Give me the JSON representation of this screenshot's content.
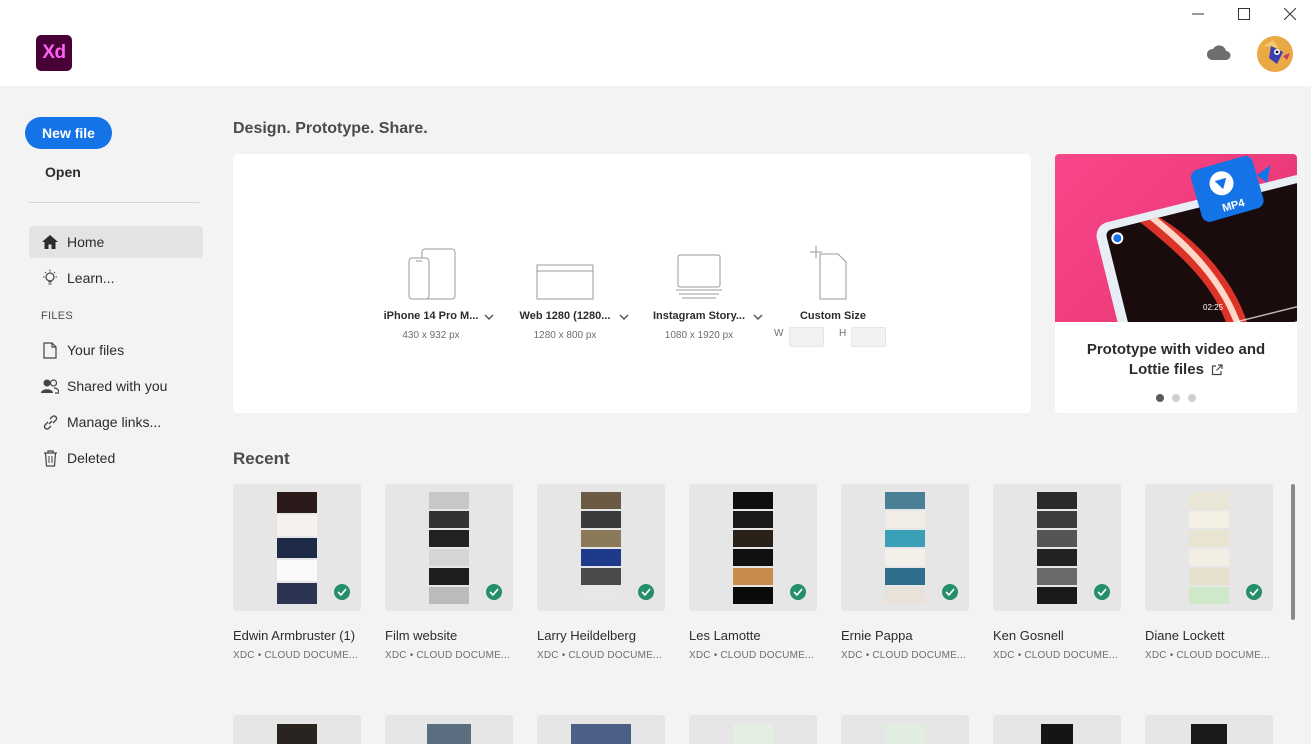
{
  "app": {
    "logo_text": "Xd"
  },
  "window_controls": [
    "minimize",
    "maximize",
    "close"
  ],
  "sidebar": {
    "new_file_label": "New file",
    "open_label": "Open",
    "files_heading": "FILES",
    "items": [
      {
        "label": "Home",
        "icon": "home-icon"
      },
      {
        "label": "Learn...",
        "icon": "lightbulb-icon"
      },
      {
        "label": "Your files",
        "icon": "document-icon"
      },
      {
        "label": "Shared with you",
        "icon": "people-icon"
      },
      {
        "label": "Manage links...",
        "icon": "link-icon"
      },
      {
        "label": "Deleted",
        "icon": "trash-icon"
      }
    ]
  },
  "main": {
    "tagline": "Design. Prototype. Share.",
    "presets": [
      {
        "name": "iPhone 14 Pro M...",
        "dims": "430 x 932 px"
      },
      {
        "name": "Web 1280 (1280...",
        "dims": "1280 x 800 px"
      },
      {
        "name": "Instagram Story...",
        "dims": "1080 x 1920 px"
      },
      {
        "name": "Custom Size",
        "w_label": "W",
        "h_label": "H"
      }
    ],
    "promo": {
      "title": "Prototype with video and Lottie files",
      "badge": "MP4",
      "time": "02:25",
      "pages": 3,
      "active_page": 1
    },
    "recent_heading": "Recent",
    "recent_files": [
      {
        "name": "Edwin Armbruster (1)",
        "meta": "XDC • CLOUD DOCUME..."
      },
      {
        "name": "Film website",
        "meta": "XDC • CLOUD DOCUME..."
      },
      {
        "name": "Larry Heildelberg",
        "meta": "XDC • CLOUD DOCUME..."
      },
      {
        "name": "Les Lamotte",
        "meta": "XDC • CLOUD DOCUME..."
      },
      {
        "name": "Ernie Pappa",
        "meta": "XDC • CLOUD DOCUME..."
      },
      {
        "name": "Ken Gosnell",
        "meta": "XDC • CLOUD DOCUME..."
      },
      {
        "name": "Diane Lockett",
        "meta": "XDC • CLOUD DOCUME..."
      }
    ]
  },
  "colors": {
    "accent": "#1473e6",
    "xd_bg": "#470137",
    "xd_fg": "#ff61f6",
    "synced": "#268e6c"
  }
}
